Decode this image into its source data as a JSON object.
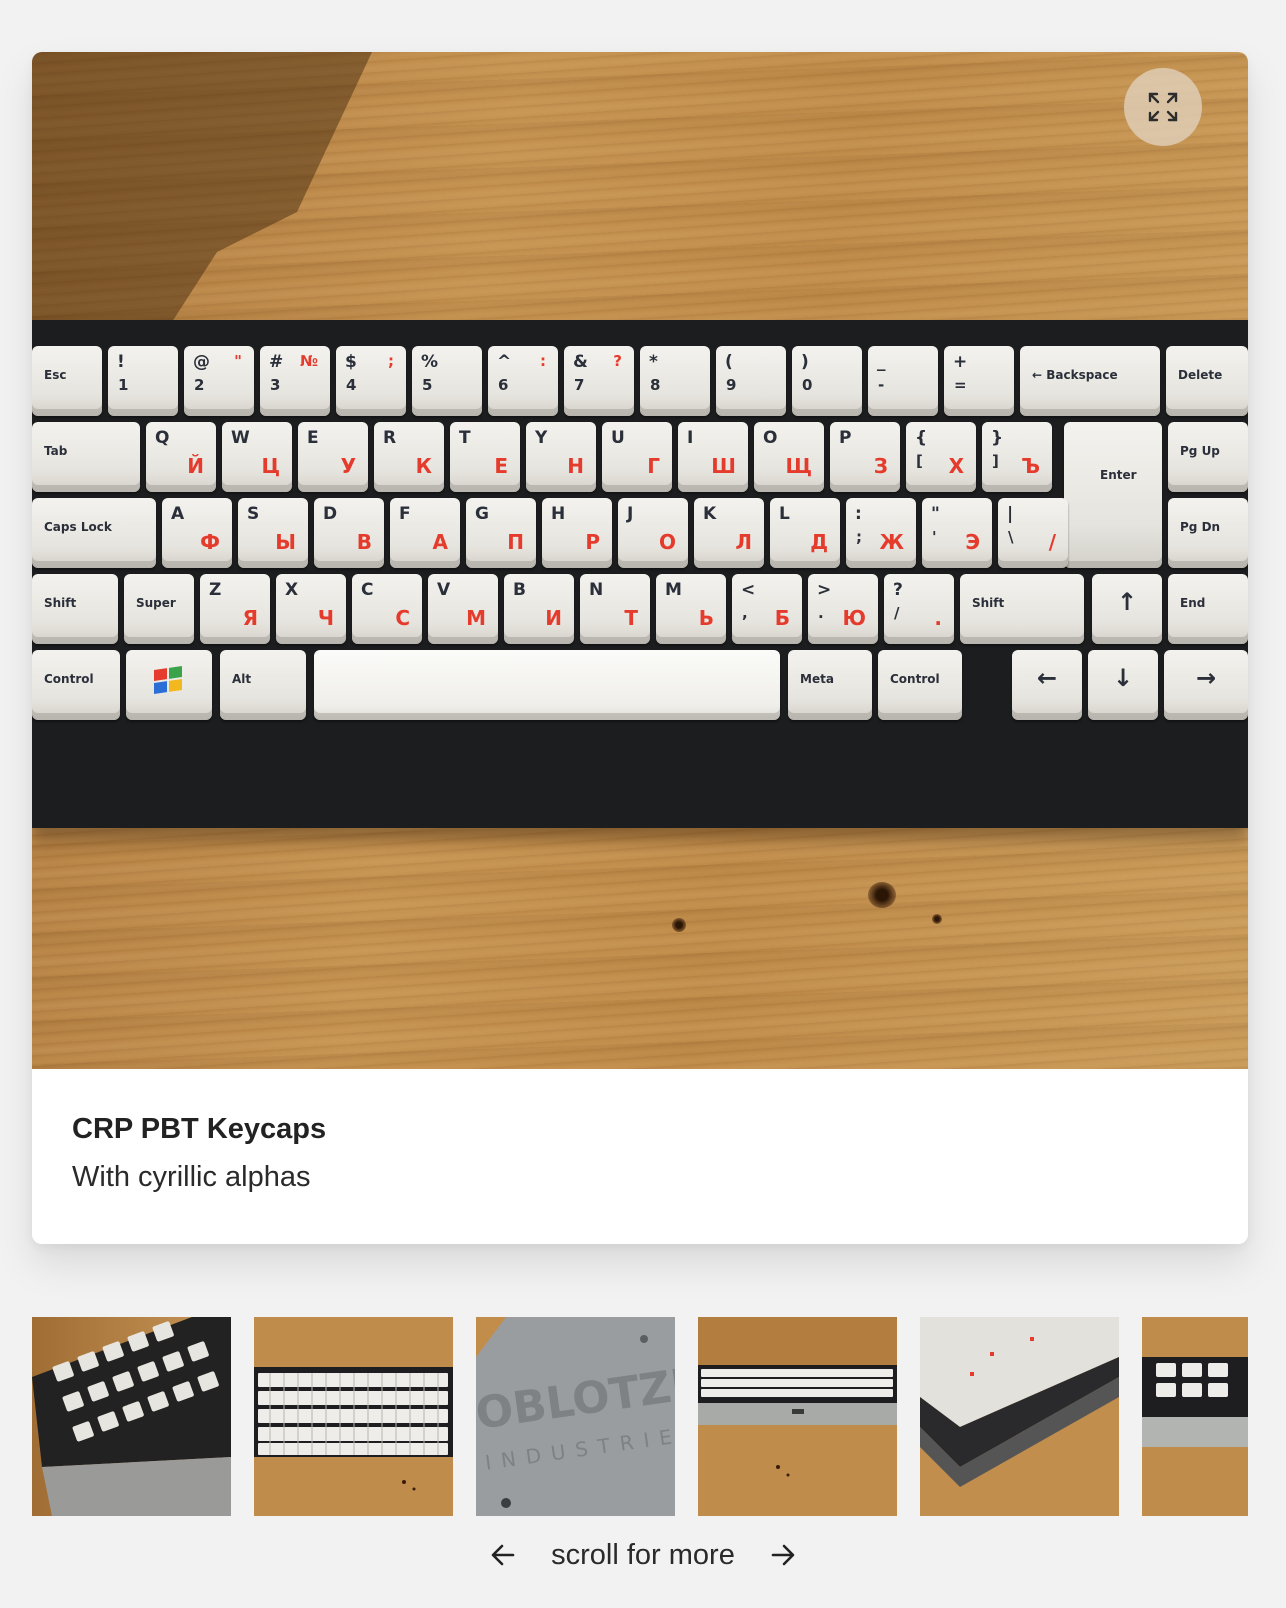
{
  "product": {
    "title": "CRP PBT Keycaps",
    "subtitle": "With cyrillic alphas"
  },
  "photo": {
    "expand_icon": "expand-icon"
  },
  "keyboard": {
    "row1": [
      {
        "t": "Esc"
      },
      {
        "t": "!",
        "b": "1"
      },
      {
        "t": "@",
        "b": "2",
        "r": "\""
      },
      {
        "t": "#",
        "b": "3",
        "r": "№"
      },
      {
        "t": "$",
        "b": "4",
        "r": ";"
      },
      {
        "t": "%",
        "b": "5"
      },
      {
        "t": "^",
        "b": "6",
        "r": ":"
      },
      {
        "t": "&",
        "b": "7",
        "r": "?"
      },
      {
        "t": "*",
        "b": "8"
      },
      {
        "t": "(",
        "b": "9"
      },
      {
        "t": ")",
        "b": "0"
      },
      {
        "t": "_",
        "b": "-"
      },
      {
        "t": "+",
        "b": "="
      },
      {
        "t": "← Backspace"
      },
      {
        "t": "Delete"
      }
    ],
    "row2": [
      {
        "t": "Tab"
      },
      {
        "t": "Q",
        "ru": "Й"
      },
      {
        "t": "W",
        "ru": "Ц"
      },
      {
        "t": "E",
        "ru": "У"
      },
      {
        "t": "R",
        "ru": "К"
      },
      {
        "t": "T",
        "ru": "Е"
      },
      {
        "t": "Y",
        "ru": "Н"
      },
      {
        "t": "U",
        "ru": "Г"
      },
      {
        "t": "I",
        "ru": "Ш"
      },
      {
        "t": "O",
        "ru": "Щ"
      },
      {
        "t": "P",
        "ru": "З"
      },
      {
        "t": "{",
        "b": "[",
        "ru": "Х"
      },
      {
        "t": "}",
        "b": "]",
        "ru": "Ъ"
      },
      {
        "t": "Enter"
      },
      {
        "t": "Pg Up"
      }
    ],
    "row3": [
      {
        "t": "Caps Lock"
      },
      {
        "t": "A",
        "ru": "Ф"
      },
      {
        "t": "S",
        "ru": "Ы"
      },
      {
        "t": "D",
        "ru": "В"
      },
      {
        "t": "F",
        "ru": "А"
      },
      {
        "t": "G",
        "ru": "П"
      },
      {
        "t": "H",
        "ru": "Р"
      },
      {
        "t": "J",
        "ru": "О"
      },
      {
        "t": "K",
        "ru": "Л"
      },
      {
        "t": "L",
        "ru": "Д"
      },
      {
        "t": ":",
        "b": ";",
        "ru": "Ж"
      },
      {
        "t": "\"",
        "b": "'",
        "ru": "Э"
      },
      {
        "t": "|",
        "b": "\\",
        "ru": "/"
      },
      {
        "t": "Pg Dn"
      }
    ],
    "row4": [
      {
        "t": "Shift"
      },
      {
        "t": "Super"
      },
      {
        "t": "Z",
        "ru": "Я"
      },
      {
        "t": "X",
        "ru": "Ч"
      },
      {
        "t": "C",
        "ru": "С"
      },
      {
        "t": "V",
        "ru": "М"
      },
      {
        "t": "B",
        "ru": "И"
      },
      {
        "t": "N",
        "ru": "Т"
      },
      {
        "t": "M",
        "ru": "Ь"
      },
      {
        "t": "<",
        "b": ",",
        "ru": "Б"
      },
      {
        "t": ">",
        "b": ".",
        "ru": "Ю"
      },
      {
        "t": "?",
        "b": "/",
        "ru": "."
      },
      {
        "t": "Shift"
      },
      {
        "t": "↑"
      },
      {
        "t": "End"
      }
    ],
    "row5": [
      {
        "t": "Control"
      },
      {
        "t": ""
      },
      {
        "t": "Alt"
      },
      {
        "t": ""
      },
      {
        "t": "Meta"
      },
      {
        "t": "Control"
      },
      {
        "t": "←"
      },
      {
        "t": "↓"
      },
      {
        "t": "→"
      }
    ]
  },
  "thumbnails": [
    {
      "name": "thumb-1",
      "alt_icon": "keyboard-angle-photo"
    },
    {
      "name": "thumb-2",
      "alt_icon": "keyboard-top-photo"
    },
    {
      "name": "thumb-3",
      "alt_icon": "case-bottom-photo"
    },
    {
      "name": "thumb-4",
      "alt_icon": "keyboard-front-photo"
    },
    {
      "name": "thumb-5",
      "alt_icon": "keyboard-side-photo"
    },
    {
      "name": "thumb-6",
      "alt_icon": "keyboard-corner-photo"
    }
  ],
  "pager": {
    "label": "scroll for more",
    "prev_icon": "arrow-left-icon",
    "next_icon": "arrow-right-icon"
  },
  "colors": {
    "background": "#f2f2f2",
    "card": "#ffffff",
    "legend_red": "#e53b2d",
    "legend_dark": "#2a2f3a"
  }
}
